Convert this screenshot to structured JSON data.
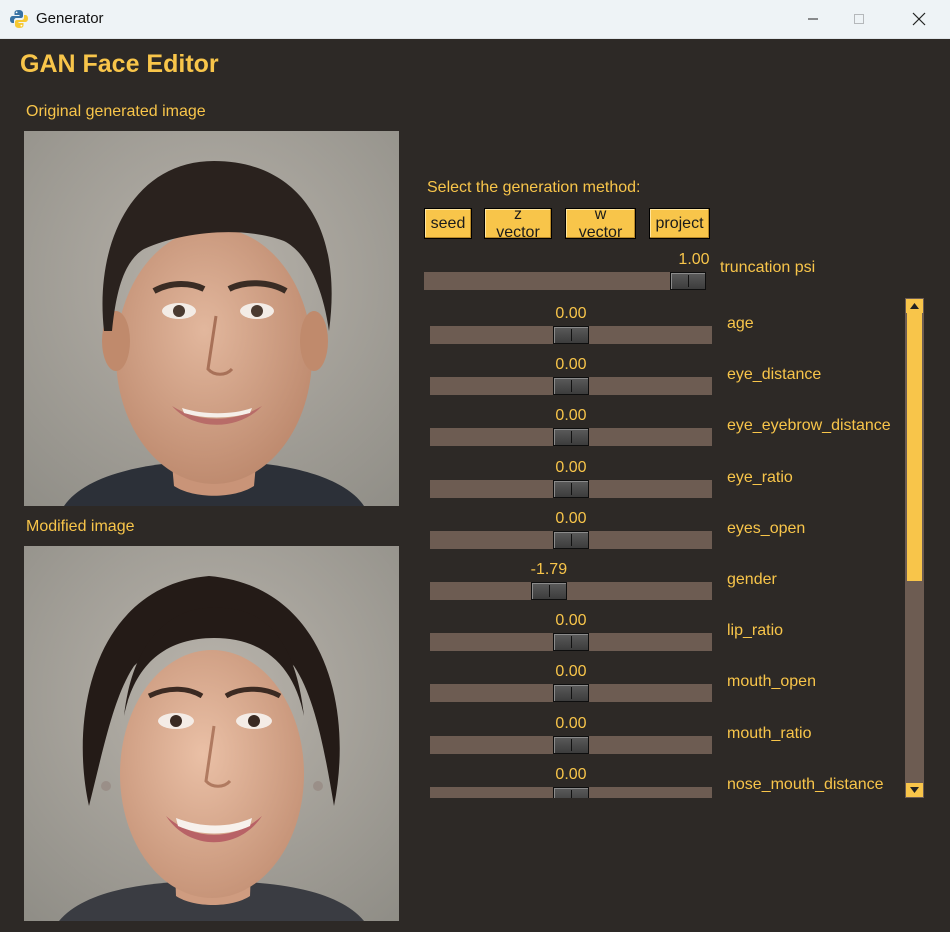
{
  "window": {
    "title": "Generator"
  },
  "heading": "GAN Face Editor",
  "images": {
    "original_label": "Original generated image",
    "modified_label": "Modified image"
  },
  "method": {
    "label": "Select the generation method:",
    "buttons": [
      "seed",
      "z vector",
      "w vector",
      "project"
    ]
  },
  "truncation": {
    "name": "truncation psi",
    "value": "1.00",
    "fraction": 1.0
  },
  "attributes": [
    {
      "name": "age",
      "value": "0.00",
      "fraction": 0.5
    },
    {
      "name": "eye_distance",
      "value": "0.00",
      "fraction": 0.5
    },
    {
      "name": "eye_eyebrow_distance",
      "value": "0.00",
      "fraction": 0.5
    },
    {
      "name": "eye_ratio",
      "value": "0.00",
      "fraction": 0.5
    },
    {
      "name": "eyes_open",
      "value": "0.00",
      "fraction": 0.5
    },
    {
      "name": "gender",
      "value": "-1.79",
      "fraction": 0.41
    },
    {
      "name": "lip_ratio",
      "value": "0.00",
      "fraction": 0.5
    },
    {
      "name": "mouth_open",
      "value": "0.00",
      "fraction": 0.5
    },
    {
      "name": "mouth_ratio",
      "value": "0.00",
      "fraction": 0.5
    },
    {
      "name": "nose_mouth_distance",
      "value": "0.00",
      "fraction": 0.5
    }
  ],
  "scroll": {
    "fraction": 0.57
  },
  "colors": {
    "accent": "#f8c54a",
    "background": "#2d2926",
    "track": "#6d5c52"
  },
  "icons": {
    "app": "python-icon",
    "minimize": "minimize-icon",
    "maximize": "maximize-icon",
    "close": "close-icon",
    "scroll_up": "triangle-up-icon",
    "scroll_down": "triangle-down-icon"
  }
}
